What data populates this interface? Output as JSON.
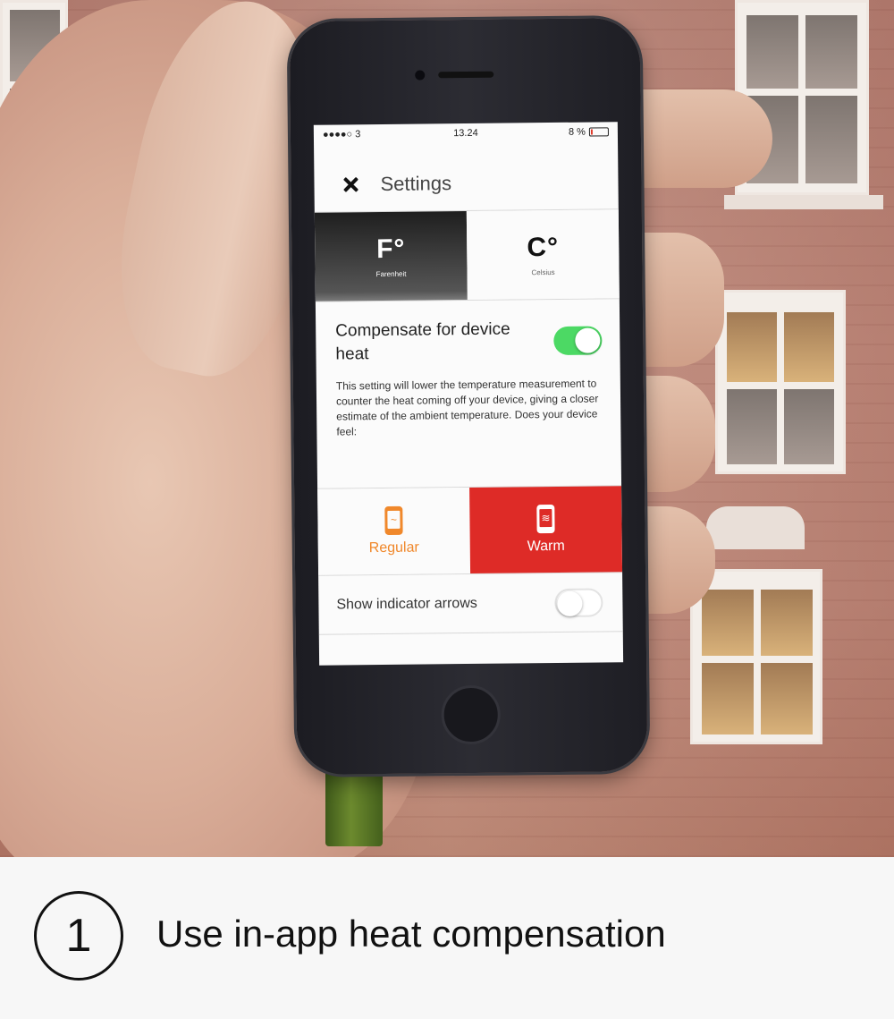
{
  "screen": {
    "status": {
      "carrier": "●●●●○ 3",
      "time": "13.24",
      "battery": "8 %"
    },
    "nav": {
      "title": "Settings"
    },
    "units": [
      {
        "symbol": "F°",
        "label": "Farenheit",
        "selected": true
      },
      {
        "symbol": "C°",
        "label": "Celsius",
        "selected": false
      }
    ],
    "compensation": {
      "title": "Compensate for device heat",
      "enabled": true,
      "description": "This setting will lower the temperature measurement to counter the heat coming off your device, giving a closer estimate of the ambient temperature. Does your device feel:"
    },
    "heat_options": [
      {
        "label": "Regular",
        "selected": false
      },
      {
        "label": "Warm",
        "selected": true
      }
    ],
    "indicator_arrows": {
      "label": "Show indicator arrows",
      "enabled": false
    }
  },
  "caption": {
    "step": "1",
    "text": "Use in-app heat compensation"
  },
  "colors": {
    "toggle_on": "#4cd964",
    "warm": "#de2b27",
    "regular": "#f0882b"
  }
}
